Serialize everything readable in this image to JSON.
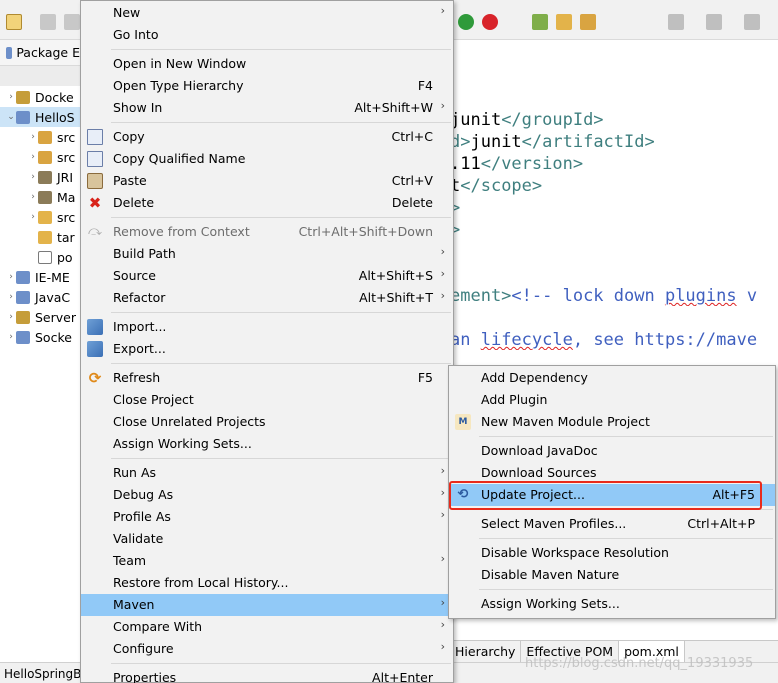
{
  "package_explorer": {
    "tab_label": "Package E",
    "tree": [
      {
        "label": "Docke",
        "arrow": "›",
        "color": "#c59d3a",
        "selected": false
      },
      {
        "label": "HelloS",
        "arrow": "⌄",
        "color": "#6d8fc9",
        "selected": true
      },
      {
        "label": "src",
        "arrow": "›",
        "color": "#d9a441",
        "selected": false
      },
      {
        "label": "src",
        "arrow": "›",
        "color": "#d9a441",
        "selected": false
      },
      {
        "label": "JRI",
        "arrow": "›",
        "color": "#8b7b58",
        "selected": false
      },
      {
        "label": "Ma",
        "arrow": "›",
        "color": "#8b7b58",
        "selected": false
      },
      {
        "label": "src",
        "arrow": "›",
        "color": "#e3b34a",
        "selected": false
      },
      {
        "label": "tar",
        "arrow": "",
        "color": "#e3b34a",
        "selected": false
      },
      {
        "label": "po",
        "arrow": "",
        "color": "#ffffff",
        "selected": false
      },
      {
        "label": "IE-ME",
        "arrow": "›",
        "color": "#6d8fc9",
        "selected": false
      },
      {
        "label": "JavaC",
        "arrow": "›",
        "color": "#6d8fc9",
        "selected": false
      },
      {
        "label": "Server",
        "arrow": "›",
        "color": "#c59d3a",
        "selected": false
      },
      {
        "label": "Socke",
        "arrow": "›",
        "color": "#6d8fc9",
        "selected": false
      }
    ]
  },
  "editor": {
    "lines": [
      {
        "parts": [
          {
            "t": "junit",
            "c": "txt"
          },
          {
            "t": "</groupId>",
            "c": "tag"
          }
        ]
      },
      {
        "parts": [
          {
            "t": "d>",
            "c": "tag"
          },
          {
            "t": "junit",
            "c": "txt"
          },
          {
            "t": "</artifactId>",
            "c": "tag"
          }
        ]
      },
      {
        "parts": [
          {
            "t": ".11",
            "c": "txt"
          },
          {
            "t": "</version>",
            "c": "tag"
          }
        ]
      },
      {
        "parts": [
          {
            "t": "t",
            "c": "txt"
          },
          {
            "t": "</scope>",
            "c": "tag"
          }
        ]
      },
      {
        "parts": [
          {
            "t": ">",
            "c": "tag"
          }
        ]
      },
      {
        "parts": [
          {
            "t": ">",
            "c": "tag"
          }
        ]
      },
      {
        "parts": [
          {
            "t": "",
            "c": "txt"
          }
        ]
      },
      {
        "parts": [
          {
            "t": "",
            "c": "txt"
          }
        ]
      },
      {
        "parts": [
          {
            "t": "ement>",
            "c": "tag"
          },
          {
            "t": "<!-- lock down ",
            "c": "cmt"
          },
          {
            "t": "plugins",
            "c": "cmt squig"
          },
          {
            "t": " v",
            "c": "cmt"
          }
        ]
      },
      {
        "parts": [
          {
            "t": "",
            "c": "txt"
          }
        ]
      },
      {
        "parts": [
          {
            "t": "an ",
            "c": "cmt"
          },
          {
            "t": "lifecycle",
            "c": "cmt squig"
          },
          {
            "t": ", see https://mave",
            "c": "cmt"
          }
        ]
      }
    ],
    "tabs": [
      {
        "label": "Hierarchy",
        "active": false
      },
      {
        "label": "Effective POM",
        "active": false
      },
      {
        "label": "pom.xml",
        "active": true
      }
    ]
  },
  "status_bar": {
    "text": "HelloSpringB"
  },
  "watermark": "https://blog.csdn.net/qq_19331935",
  "context_menu": {
    "items": [
      {
        "type": "item",
        "label": "New",
        "submenu": true
      },
      {
        "type": "item",
        "label": "Go Into"
      },
      {
        "type": "sep"
      },
      {
        "type": "item",
        "label": "Open in New Window"
      },
      {
        "type": "item",
        "label": "Open Type Hierarchy",
        "shortcut": "F4"
      },
      {
        "type": "item",
        "label": "Show In",
        "shortcut": "Alt+Shift+W",
        "submenu": true
      },
      {
        "type": "sep"
      },
      {
        "type": "item",
        "label": "Copy",
        "shortcut": "Ctrl+C",
        "icon": "copy-icon"
      },
      {
        "type": "item",
        "label": "Copy Qualified Name",
        "icon": "copy-qualified-icon"
      },
      {
        "type": "item",
        "label": "Paste",
        "shortcut": "Ctrl+V",
        "icon": "paste-icon"
      },
      {
        "type": "item",
        "label": "Delete",
        "shortcut": "Delete",
        "icon": "delete-icon"
      },
      {
        "type": "sep"
      },
      {
        "type": "item",
        "label": "Remove from Context",
        "shortcut": "Ctrl+Alt+Shift+Down",
        "disabled": true,
        "icon": "remove-context-icon"
      },
      {
        "type": "item",
        "label": "Build Path",
        "submenu": true
      },
      {
        "type": "item",
        "label": "Source",
        "shortcut": "Alt+Shift+S",
        "submenu": true
      },
      {
        "type": "item",
        "label": "Refactor",
        "shortcut": "Alt+Shift+T",
        "submenu": true
      },
      {
        "type": "sep"
      },
      {
        "type": "item",
        "label": "Import...",
        "icon": "import-icon"
      },
      {
        "type": "item",
        "label": "Export...",
        "icon": "export-icon"
      },
      {
        "type": "sep"
      },
      {
        "type": "item",
        "label": "Refresh",
        "shortcut": "F5",
        "icon": "refresh-icon"
      },
      {
        "type": "item",
        "label": "Close Project"
      },
      {
        "type": "item",
        "label": "Close Unrelated Projects"
      },
      {
        "type": "item",
        "label": "Assign Working Sets..."
      },
      {
        "type": "sep"
      },
      {
        "type": "item",
        "label": "Run As",
        "submenu": true
      },
      {
        "type": "item",
        "label": "Debug As",
        "submenu": true
      },
      {
        "type": "item",
        "label": "Profile As",
        "submenu": true
      },
      {
        "type": "item",
        "label": "Validate"
      },
      {
        "type": "item",
        "label": "Team",
        "submenu": true
      },
      {
        "type": "item",
        "label": "Restore from Local History..."
      },
      {
        "type": "item",
        "label": "Maven",
        "submenu": true,
        "highlighted": true
      },
      {
        "type": "item",
        "label": "Compare With",
        "submenu": true
      },
      {
        "type": "item",
        "label": "Configure",
        "submenu": true
      },
      {
        "type": "sep"
      },
      {
        "type": "item",
        "label": "Properties",
        "shortcut": "Alt+Enter"
      }
    ]
  },
  "maven_submenu": {
    "items": [
      {
        "type": "item",
        "label": "Add Dependency"
      },
      {
        "type": "item",
        "label": "Add Plugin"
      },
      {
        "type": "item",
        "label": "New Maven Module Project",
        "icon": "maven-module-icon"
      },
      {
        "type": "sep"
      },
      {
        "type": "item",
        "label": "Download JavaDoc"
      },
      {
        "type": "item",
        "label": "Download Sources"
      },
      {
        "type": "item",
        "label": "Update Project...",
        "shortcut": "Alt+F5",
        "icon": "update-project-icon",
        "highlighted": true
      },
      {
        "type": "sep"
      },
      {
        "type": "item",
        "label": "Select Maven Profiles...",
        "shortcut": "Ctrl+Alt+P"
      },
      {
        "type": "sep"
      },
      {
        "type": "item",
        "label": "Disable Workspace Resolution"
      },
      {
        "type": "item",
        "label": "Disable Maven Nature"
      },
      {
        "type": "sep"
      },
      {
        "type": "item",
        "label": "Assign Working Sets..."
      }
    ]
  },
  "colors": {
    "highlight": "#91c9f7",
    "annotation_box": "#e82a1c"
  }
}
